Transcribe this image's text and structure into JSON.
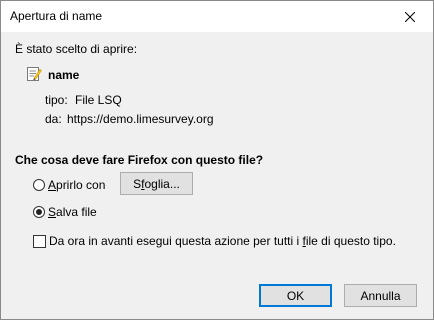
{
  "window": {
    "title": "Apertura di name",
    "close_icon": "close-icon"
  },
  "intro_text": "È stato scelto di aprire:",
  "file": {
    "icon": "document-edit-icon",
    "name": "name",
    "type_label": "tipo:",
    "type_value": "File LSQ",
    "from_label": "da:",
    "from_value": "https://demo.limesurvey.org"
  },
  "question": "Che cosa deve fare Firefox con questo file?",
  "options": {
    "open": {
      "label_prefix": "",
      "label_accel": "A",
      "label_rest": "prirlo con",
      "selected": false
    },
    "browse_button": {
      "label_prefix": "S",
      "label_accel": "f",
      "label_rest": "oglia..."
    },
    "save": {
      "label_prefix": "",
      "label_accel": "S",
      "label_rest": "alva file",
      "selected": true
    }
  },
  "remember": {
    "label_prefix": "Da ora in avanti esegui questa azione per tutti i ",
    "label_accel": "f",
    "label_rest": "ile di questo tipo.",
    "checked": false
  },
  "buttons": {
    "ok": "OK",
    "cancel": "Annulla"
  },
  "colors": {
    "dialog_bg": "#f0f0f0",
    "title_bg": "#ffffff",
    "default_button_border": "#0078d7"
  }
}
